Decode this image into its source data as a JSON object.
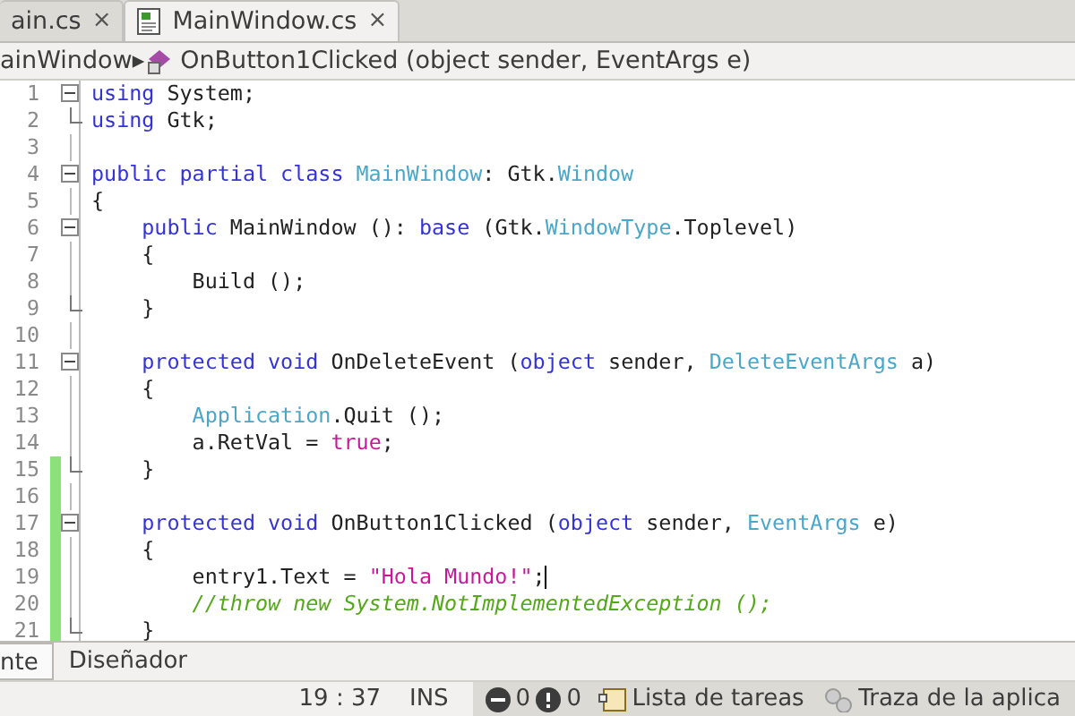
{
  "tabs": [
    {
      "label": "ain.cs",
      "selected": false,
      "close": "×"
    },
    {
      "label": "MainWindow.cs",
      "selected": true,
      "close": "×"
    }
  ],
  "breadcrumb": {
    "parent": "ainWindow",
    "separator": "▸",
    "member": "OnButton1Clicked (object sender, EventArgs e)"
  },
  "editor": {
    "lines": [
      {
        "number": "1",
        "fold_start": true,
        "fold_end": false,
        "changed": false,
        "tokens": [
          {
            "kind": "keyword",
            "text": "using"
          },
          {
            "kind": "plain",
            "text": " System;"
          }
        ]
      },
      {
        "number": "2",
        "fold_start": false,
        "fold_end": true,
        "changed": false,
        "tokens": [
          {
            "kind": "keyword",
            "text": "using"
          },
          {
            "kind": "plain",
            "text": " Gtk;"
          }
        ]
      },
      {
        "number": "3",
        "fold_start": false,
        "fold_end": false,
        "changed": false
      },
      {
        "number": "4",
        "fold_start": true,
        "fold_end": false,
        "changed": false,
        "tokens": [
          {
            "kind": "keyword",
            "text": "public partial class"
          },
          {
            "kind": "type",
            "text": " MainWindow"
          },
          {
            "kind": "plain",
            "text": ": Gtk."
          },
          {
            "kind": "type",
            "text": "Window"
          }
        ]
      },
      {
        "number": "5",
        "fold_start": false,
        "fold_end": false,
        "changed": false,
        "tokens": [
          {
            "kind": "plain",
            "text": "{"
          }
        ]
      },
      {
        "number": "6",
        "fold_start": true,
        "fold_end": false,
        "changed": false,
        "tokens": [
          {
            "kind": "keyword",
            "text": "    public"
          },
          {
            "kind": "plain",
            "text": " MainWindow (): "
          },
          {
            "kind": "keyword",
            "text": "base"
          },
          {
            "kind": "plain",
            "text": " (Gtk."
          },
          {
            "kind": "type",
            "text": "WindowType"
          },
          {
            "kind": "plain",
            "text": ".Toplevel)"
          }
        ]
      },
      {
        "number": "7",
        "fold_start": false,
        "fold_end": false,
        "changed": false,
        "tokens": [
          {
            "kind": "plain",
            "text": "    {"
          }
        ]
      },
      {
        "number": "8",
        "fold_start": false,
        "fold_end": false,
        "changed": false,
        "tokens": [
          {
            "kind": "plain",
            "text": "        Build ();"
          }
        ]
      },
      {
        "number": "9",
        "fold_start": false,
        "fold_end": true,
        "changed": false,
        "tokens": [
          {
            "kind": "plain",
            "text": "    }"
          }
        ]
      },
      {
        "number": "10",
        "fold_start": false,
        "fold_end": false,
        "changed": false
      },
      {
        "number": "11",
        "fold_start": true,
        "fold_end": false,
        "changed": false,
        "tokens": [
          {
            "kind": "keyword",
            "text": "    protected void"
          },
          {
            "kind": "plain",
            "text": " OnDeleteEvent ("
          },
          {
            "kind": "keyword",
            "text": "object"
          },
          {
            "kind": "plain",
            "text": " sender, "
          },
          {
            "kind": "type",
            "text": "DeleteEventArgs"
          },
          {
            "kind": "plain",
            "text": " a)"
          }
        ]
      },
      {
        "number": "12",
        "fold_start": false,
        "fold_end": false,
        "changed": false,
        "tokens": [
          {
            "kind": "plain",
            "text": "    {"
          }
        ]
      },
      {
        "number": "13",
        "fold_start": false,
        "fold_end": false,
        "changed": false,
        "tokens": [
          {
            "kind": "type",
            "text": "        Application"
          },
          {
            "kind": "plain",
            "text": ".Quit ();"
          }
        ]
      },
      {
        "number": "14",
        "fold_start": false,
        "fold_end": false,
        "changed": false,
        "tokens": [
          {
            "kind": "plain",
            "text": "        a.RetVal = "
          },
          {
            "kind": "literal",
            "text": "true"
          },
          {
            "kind": "plain",
            "text": ";"
          }
        ]
      },
      {
        "number": "15",
        "fold_start": false,
        "fold_end": true,
        "changed": true,
        "tokens": [
          {
            "kind": "plain",
            "text": "    }"
          }
        ]
      },
      {
        "number": "16",
        "fold_start": false,
        "fold_end": false,
        "changed": true
      },
      {
        "number": "17",
        "fold_start": true,
        "fold_end": false,
        "changed": true,
        "tokens": [
          {
            "kind": "keyword",
            "text": "    protected void"
          },
          {
            "kind": "plain",
            "text": " OnButton1Clicked ("
          },
          {
            "kind": "keyword",
            "text": "object"
          },
          {
            "kind": "plain",
            "text": " sender, "
          },
          {
            "kind": "type",
            "text": "EventArgs"
          },
          {
            "kind": "plain",
            "text": " e)"
          }
        ]
      },
      {
        "number": "18",
        "fold_start": false,
        "fold_end": false,
        "changed": true,
        "tokens": [
          {
            "kind": "plain",
            "text": "    {"
          }
        ]
      },
      {
        "number": "19",
        "fold_start": false,
        "fold_end": false,
        "changed": true,
        "cursor": true,
        "tokens": [
          {
            "kind": "plain",
            "text": "        entry1.Text = "
          },
          {
            "kind": "literal",
            "text": "\"Hola Mundo!\""
          },
          {
            "kind": "plain",
            "text": ";"
          }
        ]
      },
      {
        "number": "20",
        "fold_start": false,
        "fold_end": false,
        "changed": true,
        "tokens": [
          {
            "kind": "comment",
            "text": "        //throw new System.NotImplementedException ();"
          }
        ]
      },
      {
        "number": "21",
        "fold_start": false,
        "fold_end": true,
        "changed": true,
        "tokens": [
          {
            "kind": "plain",
            "text": "    }"
          }
        ]
      }
    ]
  },
  "view_tabs": [
    {
      "label": "nte",
      "selected": true
    },
    {
      "label": "Diseñador",
      "selected": false
    }
  ],
  "status_bar": {
    "position": "19 : 37",
    "mode": "INS",
    "errors": "0",
    "warnings": "0",
    "pads": [
      {
        "kind": "tasks",
        "label": "Lista de tareas"
      },
      {
        "kind": "trace",
        "label": "Traza de la aplica"
      }
    ]
  }
}
